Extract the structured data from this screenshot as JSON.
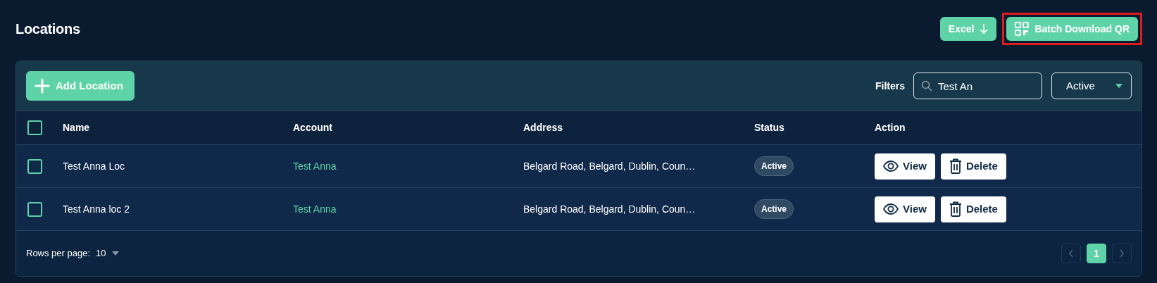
{
  "page_title": "Locations",
  "header_buttons": [
    {
      "label": "Excel",
      "kind": "excel",
      "highlighted": false
    },
    {
      "label": "Batch Download QR",
      "kind": "qr",
      "highlighted": true
    }
  ],
  "toolbar": {
    "add_button": "Add Location",
    "filters_label": "Filters",
    "search": {
      "value": "Test An"
    },
    "status_select": {
      "value": "Active"
    }
  },
  "table": {
    "select_all": {
      "checked": false
    },
    "columns": [
      "Name",
      "Account",
      "Address",
      "Status",
      "Action"
    ],
    "rows": [
      {
        "checked": false,
        "name": "Test Anna Loc",
        "account": "Test Anna",
        "address": "Belgard Road, Belgard, Dublin, Coun…",
        "status": "Active",
        "actions": [
          "View",
          "Delete"
        ]
      },
      {
        "checked": false,
        "name": "Test Anna loc 2",
        "account": "Test Anna",
        "address": "Belgard Road, Belgard, Dublin, Coun…",
        "status": "Active",
        "actions": [
          "View",
          "Delete"
        ]
      }
    ]
  },
  "footer": {
    "rows_per_page_label": "Rows per page:",
    "rows_per_page_value": "10",
    "pagination": {
      "prev_disabled": true,
      "next_disabled": true,
      "pages": [
        {
          "label": "1",
          "selected": true
        }
      ]
    }
  }
}
